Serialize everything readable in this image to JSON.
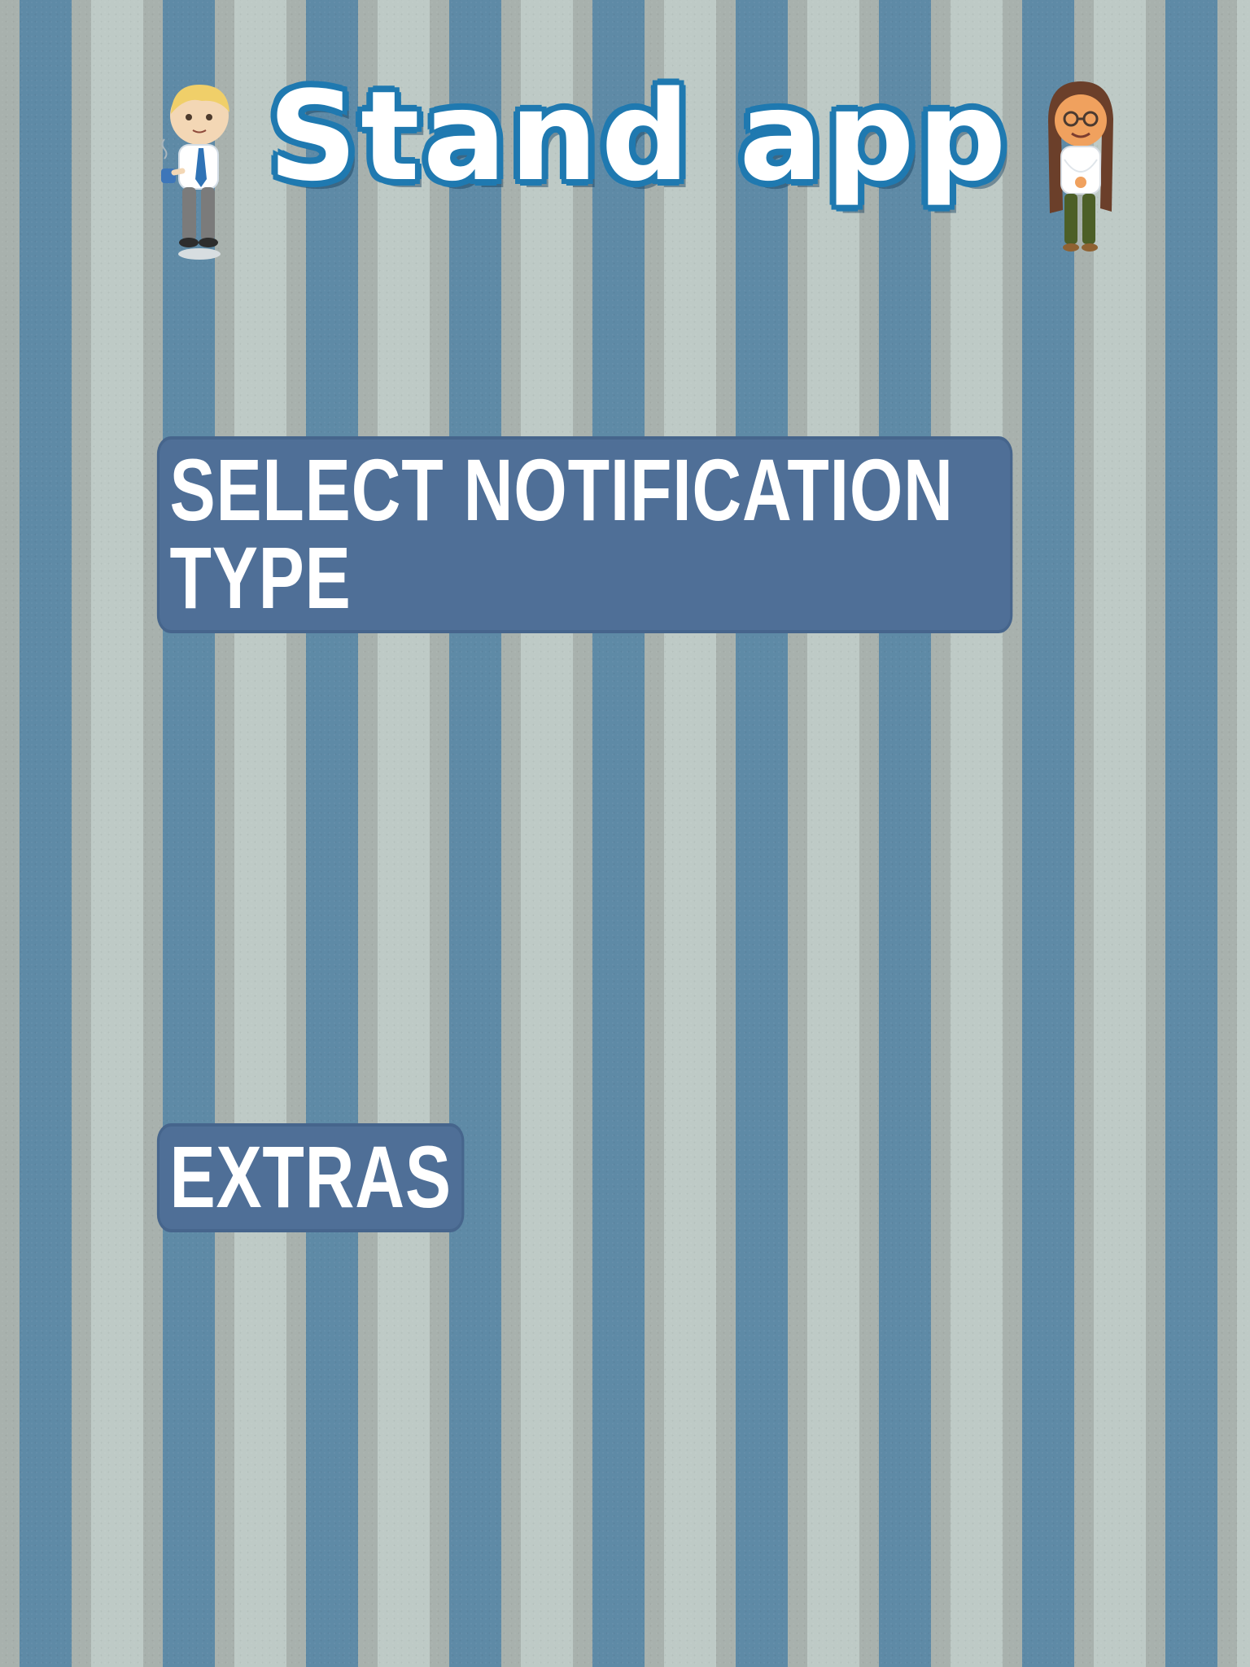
{
  "app": {
    "title": "Stand app"
  },
  "sections": {
    "notification_type_label": "SELECT NOTIFICATION TYPE",
    "extras_label": "EXTRAS"
  },
  "colors": {
    "stripe_blue": "#5e8aa6",
    "stripe_light": "#becac6",
    "heading_bg": "#4f6f97",
    "title_outline": "#1f79b0"
  }
}
